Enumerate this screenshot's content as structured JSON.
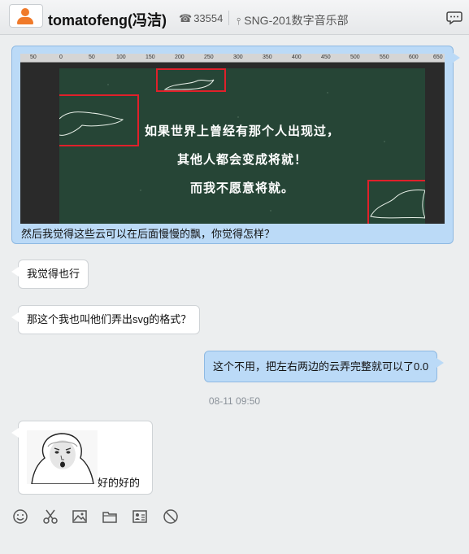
{
  "header": {
    "user_name": "tomatofeng(冯洁)",
    "phone_ext": "33554",
    "department": "SNG-201数字音乐部",
    "icons": [
      "avatar-icon",
      "phone-icon",
      "org-chart-icon",
      "chat-bubble-icon"
    ]
  },
  "messages": [
    {
      "direction": "outgoing",
      "image": {
        "ruler_ticks": [
          "50",
          "0",
          "50",
          "100",
          "150",
          "200",
          "250",
          "300",
          "350",
          "400",
          "450",
          "500",
          "550",
          "600",
          "650"
        ],
        "lines": [
          "如果世界上曾经有那个人出现过，",
          "其他人都会变成将就！",
          "而我不愿意将就。"
        ]
      },
      "text": "然后我觉得这些云可以在后面慢慢的飘，你觉得怎样？"
    },
    {
      "direction": "incoming",
      "text": "我觉得也行"
    },
    {
      "direction": "incoming",
      "text": "那这个我也叫他们弄出svg的格式？"
    },
    {
      "direction": "outgoing",
      "text": "这个不用，把左右两边的云弄完整就可以了0.0"
    }
  ],
  "timestamp": "08-11 09:50",
  "last_message": {
    "direction": "incoming",
    "sticker": "face-meme",
    "text": "好的好的"
  },
  "toolbar": {
    "icons": [
      "emoji-icon",
      "scissors-icon",
      "image-icon",
      "folder-icon",
      "contact-card-icon",
      "block-icon"
    ]
  },
  "colors": {
    "outgoing_bubble": "#bbdaf7",
    "incoming_bubble": "#ffffff",
    "highlight_box": "#e0202a",
    "board": "#264536"
  }
}
